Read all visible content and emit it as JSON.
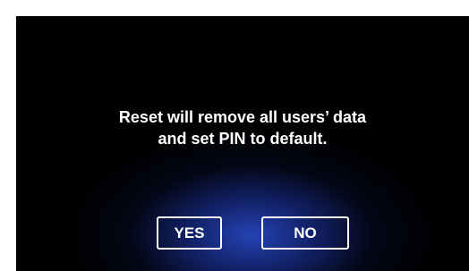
{
  "dialog": {
    "message_line1": "Reset will remove all users’ data",
    "message_line2": "and set PIN to default.",
    "yes_label": "YES",
    "no_label": "NO"
  },
  "colors": {
    "background": "#000000",
    "glow": "#2646be",
    "text": "#ffffff",
    "button_border": "#ffffff"
  }
}
